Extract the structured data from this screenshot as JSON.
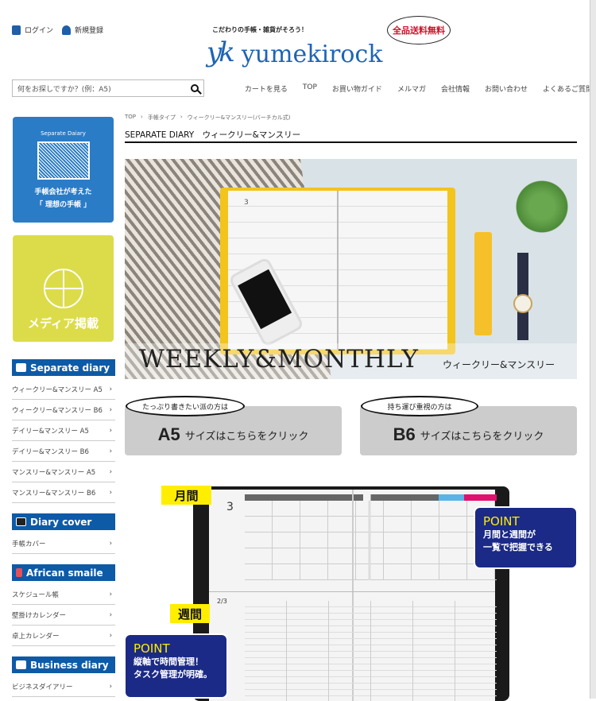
{
  "header": {
    "login": "ログイン",
    "register": "新規登録",
    "tagline": "こだわりの手帳・雑貨がそろう！",
    "logo_mark": "yk",
    "logo_text": "yumekirock",
    "free_shipping": "全品送料無料",
    "search_placeholder": "何をお探しですか？(例：A5)",
    "nav": [
      "カートを見る",
      "TOP",
      "お買い物ガイド",
      "メルマガ",
      "会社情報",
      "お問い合わせ",
      "よくあるご質問"
    ]
  },
  "sidebar": {
    "banner1": {
      "caption": "Separate Daiary",
      "line1": "手帳会社が考えた",
      "line2": "「 理想の手帳 」",
      "color": "#2a7cc7"
    },
    "banner2": {
      "label": "メディア掲載",
      "color": "#dcdc4a"
    },
    "sections": [
      {
        "title": "Separate diary",
        "items": [
          "ウィークリー&マンスリー A5",
          "ウィークリー&マンスリー B6",
          "デイリー&マンスリー A5",
          "デイリー&マンスリー B6",
          "マンスリー&マンスリー A5",
          "マンスリー&マンスリー B6"
        ]
      },
      {
        "title": "Diary cover",
        "items": [
          "手帳カバー"
        ]
      },
      {
        "title": "African smaile",
        "items": [
          "スケジュール帳",
          "壁掛けカレンダー",
          "卓上カレンダー"
        ]
      },
      {
        "title": "Business diary",
        "items": [
          "ビジネスダイアリー"
        ]
      }
    ]
  },
  "main": {
    "breadcrumb": [
      "TOP",
      "手帳タイプ",
      "ウィークリー&マンスリー(バーチカル式)"
    ],
    "title": "SEPARATE DIARY　ウィークリー&マンスリー",
    "hero": {
      "title_en": "WEEKLY&MONTHLY",
      "title_ja": "ウィークリー&マンスリー",
      "month": "3"
    },
    "size_buttons": [
      {
        "bubble": "たっぷり書きたい派の方は",
        "size": "A5",
        "label": "サイズはこちらをクリック"
      },
      {
        "bubble": "持ち運び重視の方は",
        "size": "B6",
        "label": "サイズはこちらをクリック"
      }
    ],
    "feature": {
      "monthly_label": "月間",
      "weekly_label": "週間",
      "month_number": "3",
      "week_label": "2/3",
      "point1": {
        "head": "POINT",
        "line1": "月間と週間が",
        "line2": "一覧で把握できる"
      },
      "point2": {
        "head": "POINT",
        "line1": "縦軸で時間管理！",
        "line2": "タスク管理が明確。"
      }
    }
  },
  "colors": {
    "brand": "#1e64b4",
    "section_header": "#0d5aa7",
    "point_bg": "#1b2a86",
    "highlight": "#ffee00",
    "red": "#d0102a"
  }
}
